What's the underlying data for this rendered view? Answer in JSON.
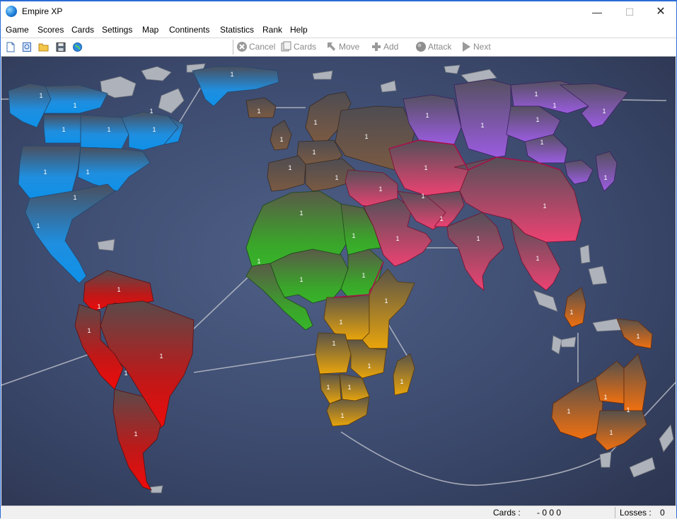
{
  "window": {
    "title": "Empire XP",
    "minimize": "—",
    "maximize": "☐",
    "close": "✕"
  },
  "menu": [
    "Game",
    "Scores",
    "Cards",
    "Settings",
    "Map",
    "Continents",
    "Statistics",
    "Rank",
    "Help"
  ],
  "toolbar": {
    "file_icons": [
      "new-document-icon",
      "preview-icon",
      "open-folder-icon",
      "save-disk-icon",
      "globe-icon"
    ],
    "actions": [
      {
        "label": "Cancel",
        "icon": "cancel-icon"
      },
      {
        "label": "Cards",
        "icon": "cards-icon"
      },
      {
        "label": "Move",
        "icon": "move-icon"
      },
      {
        "label": "Add",
        "icon": "add-icon"
      },
      {
        "label": "Attack",
        "icon": "attack-icon"
      },
      {
        "label": "Next",
        "icon": "next-icon"
      }
    ]
  },
  "map": {
    "army_label": "1",
    "continent_colors": {
      "north_america": "#1f8fe0",
      "south_america": "#e01414",
      "europe": "#6e5240",
      "africa": "#3da32b",
      "south_africa": "#e0a010",
      "middle_asia": "#e24a74",
      "north_asia": "#8a5cc8",
      "oceania": "#e0700f"
    }
  },
  "status": {
    "cards_label": "Cards :",
    "cards_value": "- 0 0 0",
    "losses_label": "Losses :",
    "losses_value": "0"
  }
}
